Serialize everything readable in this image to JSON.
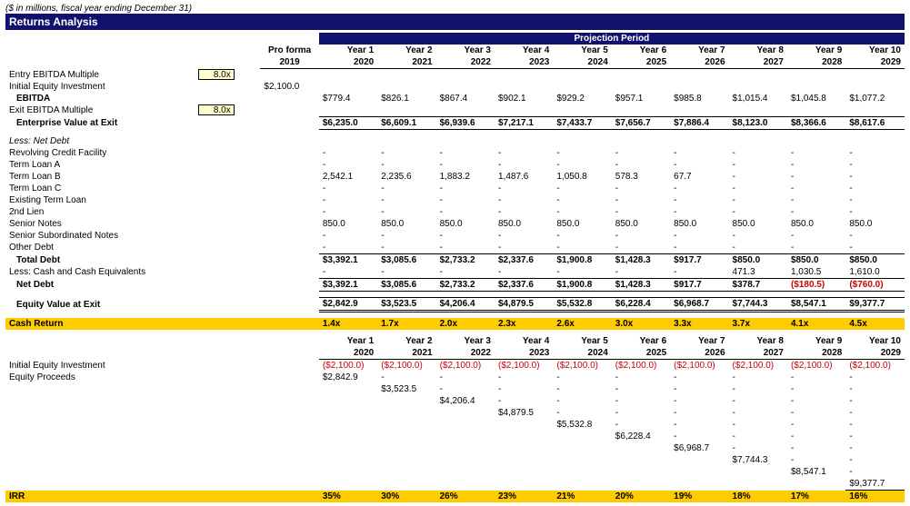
{
  "subtitle": "($ in millions, fiscal year ending December 31)",
  "title": "Returns Analysis",
  "projPeriodLabel": "Projection Period",
  "pfHead1": "Pro forma",
  "pfHead2": "2019",
  "years": {
    "y1": {
      "n": "Year 1",
      "y": "2020"
    },
    "y2": {
      "n": "Year 2",
      "y": "2021"
    },
    "y3": {
      "n": "Year 3",
      "y": "2022"
    },
    "y4": {
      "n": "Year 4",
      "y": "2023"
    },
    "y5": {
      "n": "Year 5",
      "y": "2024"
    },
    "y6": {
      "n": "Year 6",
      "y": "2025"
    },
    "y7": {
      "n": "Year 7",
      "y": "2026"
    },
    "y8": {
      "n": "Year 8",
      "y": "2027"
    },
    "y9": {
      "n": "Year 9",
      "y": "2028"
    },
    "y10": {
      "n": "Year 10",
      "y": "2029"
    }
  },
  "rows": {
    "entryMult": {
      "label": "Entry EBITDA Multiple",
      "input": "8.0x"
    },
    "initEq": {
      "label": "Initial Equity Investment",
      "pf": "$2,100.0"
    },
    "ebitda": {
      "label": "EBITDA",
      "v": [
        "$779.4",
        "$826.1",
        "$867.4",
        "$902.1",
        "$929.2",
        "$957.1",
        "$985.8",
        "$1,015.4",
        "$1,045.8",
        "$1,077.2"
      ]
    },
    "exitMult": {
      "label": "Exit EBITDA Multiple",
      "input": "8.0x"
    },
    "evExit": {
      "label": "Enterprise Value at Exit",
      "v": [
        "$6,235.0",
        "$6,609.1",
        "$6,939.6",
        "$7,217.1",
        "$7,433.7",
        "$7,656.7",
        "$7,886.4",
        "$8,123.0",
        "$8,366.6",
        "$8,617.6"
      ]
    },
    "lessNetDebt": {
      "label": "Less: Net Debt"
    },
    "revolver": {
      "label": "Revolving Credit Facility",
      "v": [
        "-",
        "-",
        "-",
        "-",
        "-",
        "-",
        "-",
        "-",
        "-",
        "-"
      ]
    },
    "tlA": {
      "label": "Term Loan A",
      "v": [
        "-",
        "-",
        "-",
        "-",
        "-",
        "-",
        "-",
        "-",
        "-",
        "-"
      ]
    },
    "tlB": {
      "label": "Term Loan B",
      "v": [
        "2,542.1",
        "2,235.6",
        "1,883.2",
        "1,487.6",
        "1,050.8",
        "578.3",
        "67.7",
        "-",
        "-",
        "-"
      ]
    },
    "tlC": {
      "label": "Term Loan C",
      "v": [
        "-",
        "-",
        "-",
        "-",
        "-",
        "-",
        "-",
        "-",
        "-",
        "-"
      ]
    },
    "exTL": {
      "label": "Existing Term Loan",
      "v": [
        "-",
        "-",
        "-",
        "-",
        "-",
        "-",
        "-",
        "-",
        "-",
        "-"
      ]
    },
    "lien2": {
      "label": "2nd Lien",
      "v": [
        "-",
        "-",
        "-",
        "-",
        "-",
        "-",
        "-",
        "-",
        "-",
        "-"
      ]
    },
    "srNotes": {
      "label": "Senior Notes",
      "v": [
        "850.0",
        "850.0",
        "850.0",
        "850.0",
        "850.0",
        "850.0",
        "850.0",
        "850.0",
        "850.0",
        "850.0"
      ]
    },
    "srSub": {
      "label": "Senior Subordinated Notes",
      "v": [
        "-",
        "-",
        "-",
        "-",
        "-",
        "-",
        "-",
        "-",
        "-",
        "-"
      ]
    },
    "otherDebt": {
      "label": "Other Debt",
      "v": [
        "-",
        "-",
        "-",
        "-",
        "-",
        "-",
        "-",
        "-",
        "-",
        "-"
      ]
    },
    "totDebt": {
      "label": "Total Debt",
      "v": [
        "$3,392.1",
        "$3,085.6",
        "$2,733.2",
        "$2,337.6",
        "$1,900.8",
        "$1,428.3",
        "$917.7",
        "$850.0",
        "$850.0",
        "$850.0"
      ]
    },
    "lessCash": {
      "label": "Less: Cash and Cash Equivalents",
      "v": [
        "-",
        "-",
        "-",
        "-",
        "-",
        "-",
        "-",
        "471.3",
        "1,030.5",
        "1,610.0"
      ]
    },
    "netDebt": {
      "label": "Net Debt",
      "v": [
        "$3,392.1",
        "$3,085.6",
        "$2,733.2",
        "$2,337.6",
        "$1,900.8",
        "$1,428.3",
        "$917.7",
        "$378.7",
        "($180.5)",
        "($760.0)"
      ]
    },
    "eqExit": {
      "label": "Equity Value at Exit",
      "v": [
        "$2,842.9",
        "$3,523.5",
        "$4,206.4",
        "$4,879.5",
        "$5,532.8",
        "$6,228.4",
        "$6,968.7",
        "$7,744.3",
        "$8,547.1",
        "$9,377.7"
      ]
    }
  },
  "cashReturn": {
    "label": "Cash Return",
    "v": [
      "1.4x",
      "1.7x",
      "2.0x",
      "2.3x",
      "2.6x",
      "3.0x",
      "3.3x",
      "3.7x",
      "4.1x",
      "4.5x"
    ]
  },
  "sec2": {
    "initEq": {
      "label": "Initial Equity Investment",
      "v": [
        "($2,100.0)",
        "($2,100.0)",
        "($2,100.0)",
        "($2,100.0)",
        "($2,100.0)",
        "($2,100.0)",
        "($2,100.0)",
        "($2,100.0)",
        "($2,100.0)",
        "($2,100.0)"
      ]
    },
    "eqProceeds": {
      "label": "Equity Proceeds"
    },
    "diag": [
      "$2,842.9",
      "$3,523.5",
      "$4,206.4",
      "$4,879.5",
      "$5,532.8",
      "$6,228.4",
      "$6,968.7",
      "$7,744.3",
      "$8,547.1",
      "$9,377.7"
    ],
    "dash": "-"
  },
  "irr": {
    "label": "IRR",
    "v": [
      "35%",
      "30%",
      "26%",
      "23%",
      "21%",
      "20%",
      "19%",
      "18%",
      "17%",
      "16%"
    ]
  },
  "chart_data": {
    "type": "table",
    "title": "Returns Analysis",
    "entry_multiple": 8.0,
    "exit_multiple": 8.0,
    "initial_equity_investment": 2100.0,
    "years": [
      2020,
      2021,
      2022,
      2023,
      2024,
      2025,
      2026,
      2027,
      2028,
      2029
    ],
    "ebitda": [
      779.4,
      826.1,
      867.4,
      902.1,
      929.2,
      957.1,
      985.8,
      1015.4,
      1045.8,
      1077.2
    ],
    "enterprise_value_at_exit": [
      6235.0,
      6609.1,
      6939.6,
      7217.1,
      7433.7,
      7656.7,
      7886.4,
      8123.0,
      8366.6,
      8617.6
    ],
    "debt": {
      "revolving_credit_facility": [
        0,
        0,
        0,
        0,
        0,
        0,
        0,
        0,
        0,
        0
      ],
      "term_loan_a": [
        0,
        0,
        0,
        0,
        0,
        0,
        0,
        0,
        0,
        0
      ],
      "term_loan_b": [
        2542.1,
        2235.6,
        1883.2,
        1487.6,
        1050.8,
        578.3,
        67.7,
        0,
        0,
        0
      ],
      "term_loan_c": [
        0,
        0,
        0,
        0,
        0,
        0,
        0,
        0,
        0,
        0
      ],
      "existing_term_loan": [
        0,
        0,
        0,
        0,
        0,
        0,
        0,
        0,
        0,
        0
      ],
      "second_lien": [
        0,
        0,
        0,
        0,
        0,
        0,
        0,
        0,
        0,
        0
      ],
      "senior_notes": [
        850.0,
        850.0,
        850.0,
        850.0,
        850.0,
        850.0,
        850.0,
        850.0,
        850.0,
        850.0
      ],
      "senior_subordinated_notes": [
        0,
        0,
        0,
        0,
        0,
        0,
        0,
        0,
        0,
        0
      ],
      "other_debt": [
        0,
        0,
        0,
        0,
        0,
        0,
        0,
        0,
        0,
        0
      ]
    },
    "total_debt": [
      3392.1,
      3085.6,
      2733.2,
      2337.6,
      1900.8,
      1428.3,
      917.7,
      850.0,
      850.0,
      850.0
    ],
    "cash_and_equivalents": [
      0,
      0,
      0,
      0,
      0,
      0,
      0,
      471.3,
      1030.5,
      1610.0
    ],
    "net_debt": [
      3392.1,
      3085.6,
      2733.2,
      2337.6,
      1900.8,
      1428.3,
      917.7,
      378.7,
      -180.5,
      -760.0
    ],
    "equity_value_at_exit": [
      2842.9,
      3523.5,
      4206.4,
      4879.5,
      5532.8,
      6228.4,
      6968.7,
      7744.3,
      8547.1,
      9377.7
    ],
    "cash_return_multiple": [
      1.4,
      1.7,
      2.0,
      2.3,
      2.6,
      3.0,
      3.3,
      3.7,
      4.1,
      4.5
    ],
    "irr_pct": [
      35,
      30,
      26,
      23,
      21,
      20,
      19,
      18,
      17,
      16
    ]
  }
}
